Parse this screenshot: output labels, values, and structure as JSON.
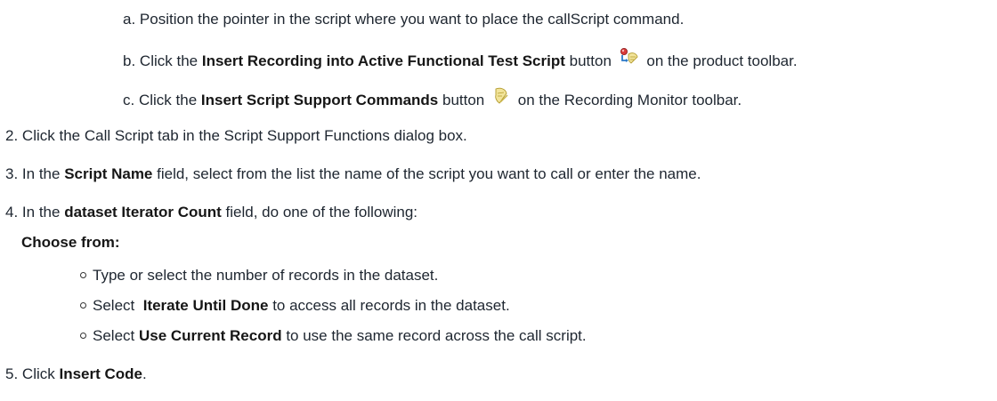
{
  "steps": {
    "a": {
      "marker": "a.",
      "text": "Position the pointer in the script where you want to place the callScript command."
    },
    "b": {
      "marker": "b.",
      "pre": "Click the ",
      "bold": "Insert Recording into Active Functional Test Script",
      "mid": " button",
      "icon": "insert-recording-icon",
      "post": "on the product toolbar."
    },
    "c": {
      "marker": "c.",
      "pre": "Click the ",
      "bold": "Insert Script Support Commands",
      "mid": " button",
      "icon": "script-support-commands-icon",
      "post": "on the Recording Monitor toolbar."
    },
    "s2": {
      "marker": "2.",
      "text": "Click the Call Script tab in the Script Support Functions dialog box."
    },
    "s3": {
      "marker": "3.",
      "pre": "In the ",
      "bold": "Script Name",
      "post": " field, select from the list the name of the script you want to call or enter the name."
    },
    "s4": {
      "marker": "4.",
      "pre": "In the ",
      "bold": "dataset Iterator Count",
      "post": " field, do one of the following:"
    },
    "choose_from": "Choose from:",
    "options": [
      {
        "text": "Type or select the number of records in the dataset."
      },
      {
        "pre": "Select ",
        "bold": "Iterate Until Done",
        "post": " to access all records in the dataset."
      },
      {
        "pre": "Select ",
        "bold": "Use Current Record",
        "post": " to use the same record across the call script."
      }
    ],
    "s5": {
      "marker": "5.",
      "pre": "Click ",
      "bold": "Insert Code",
      "post": "."
    }
  }
}
